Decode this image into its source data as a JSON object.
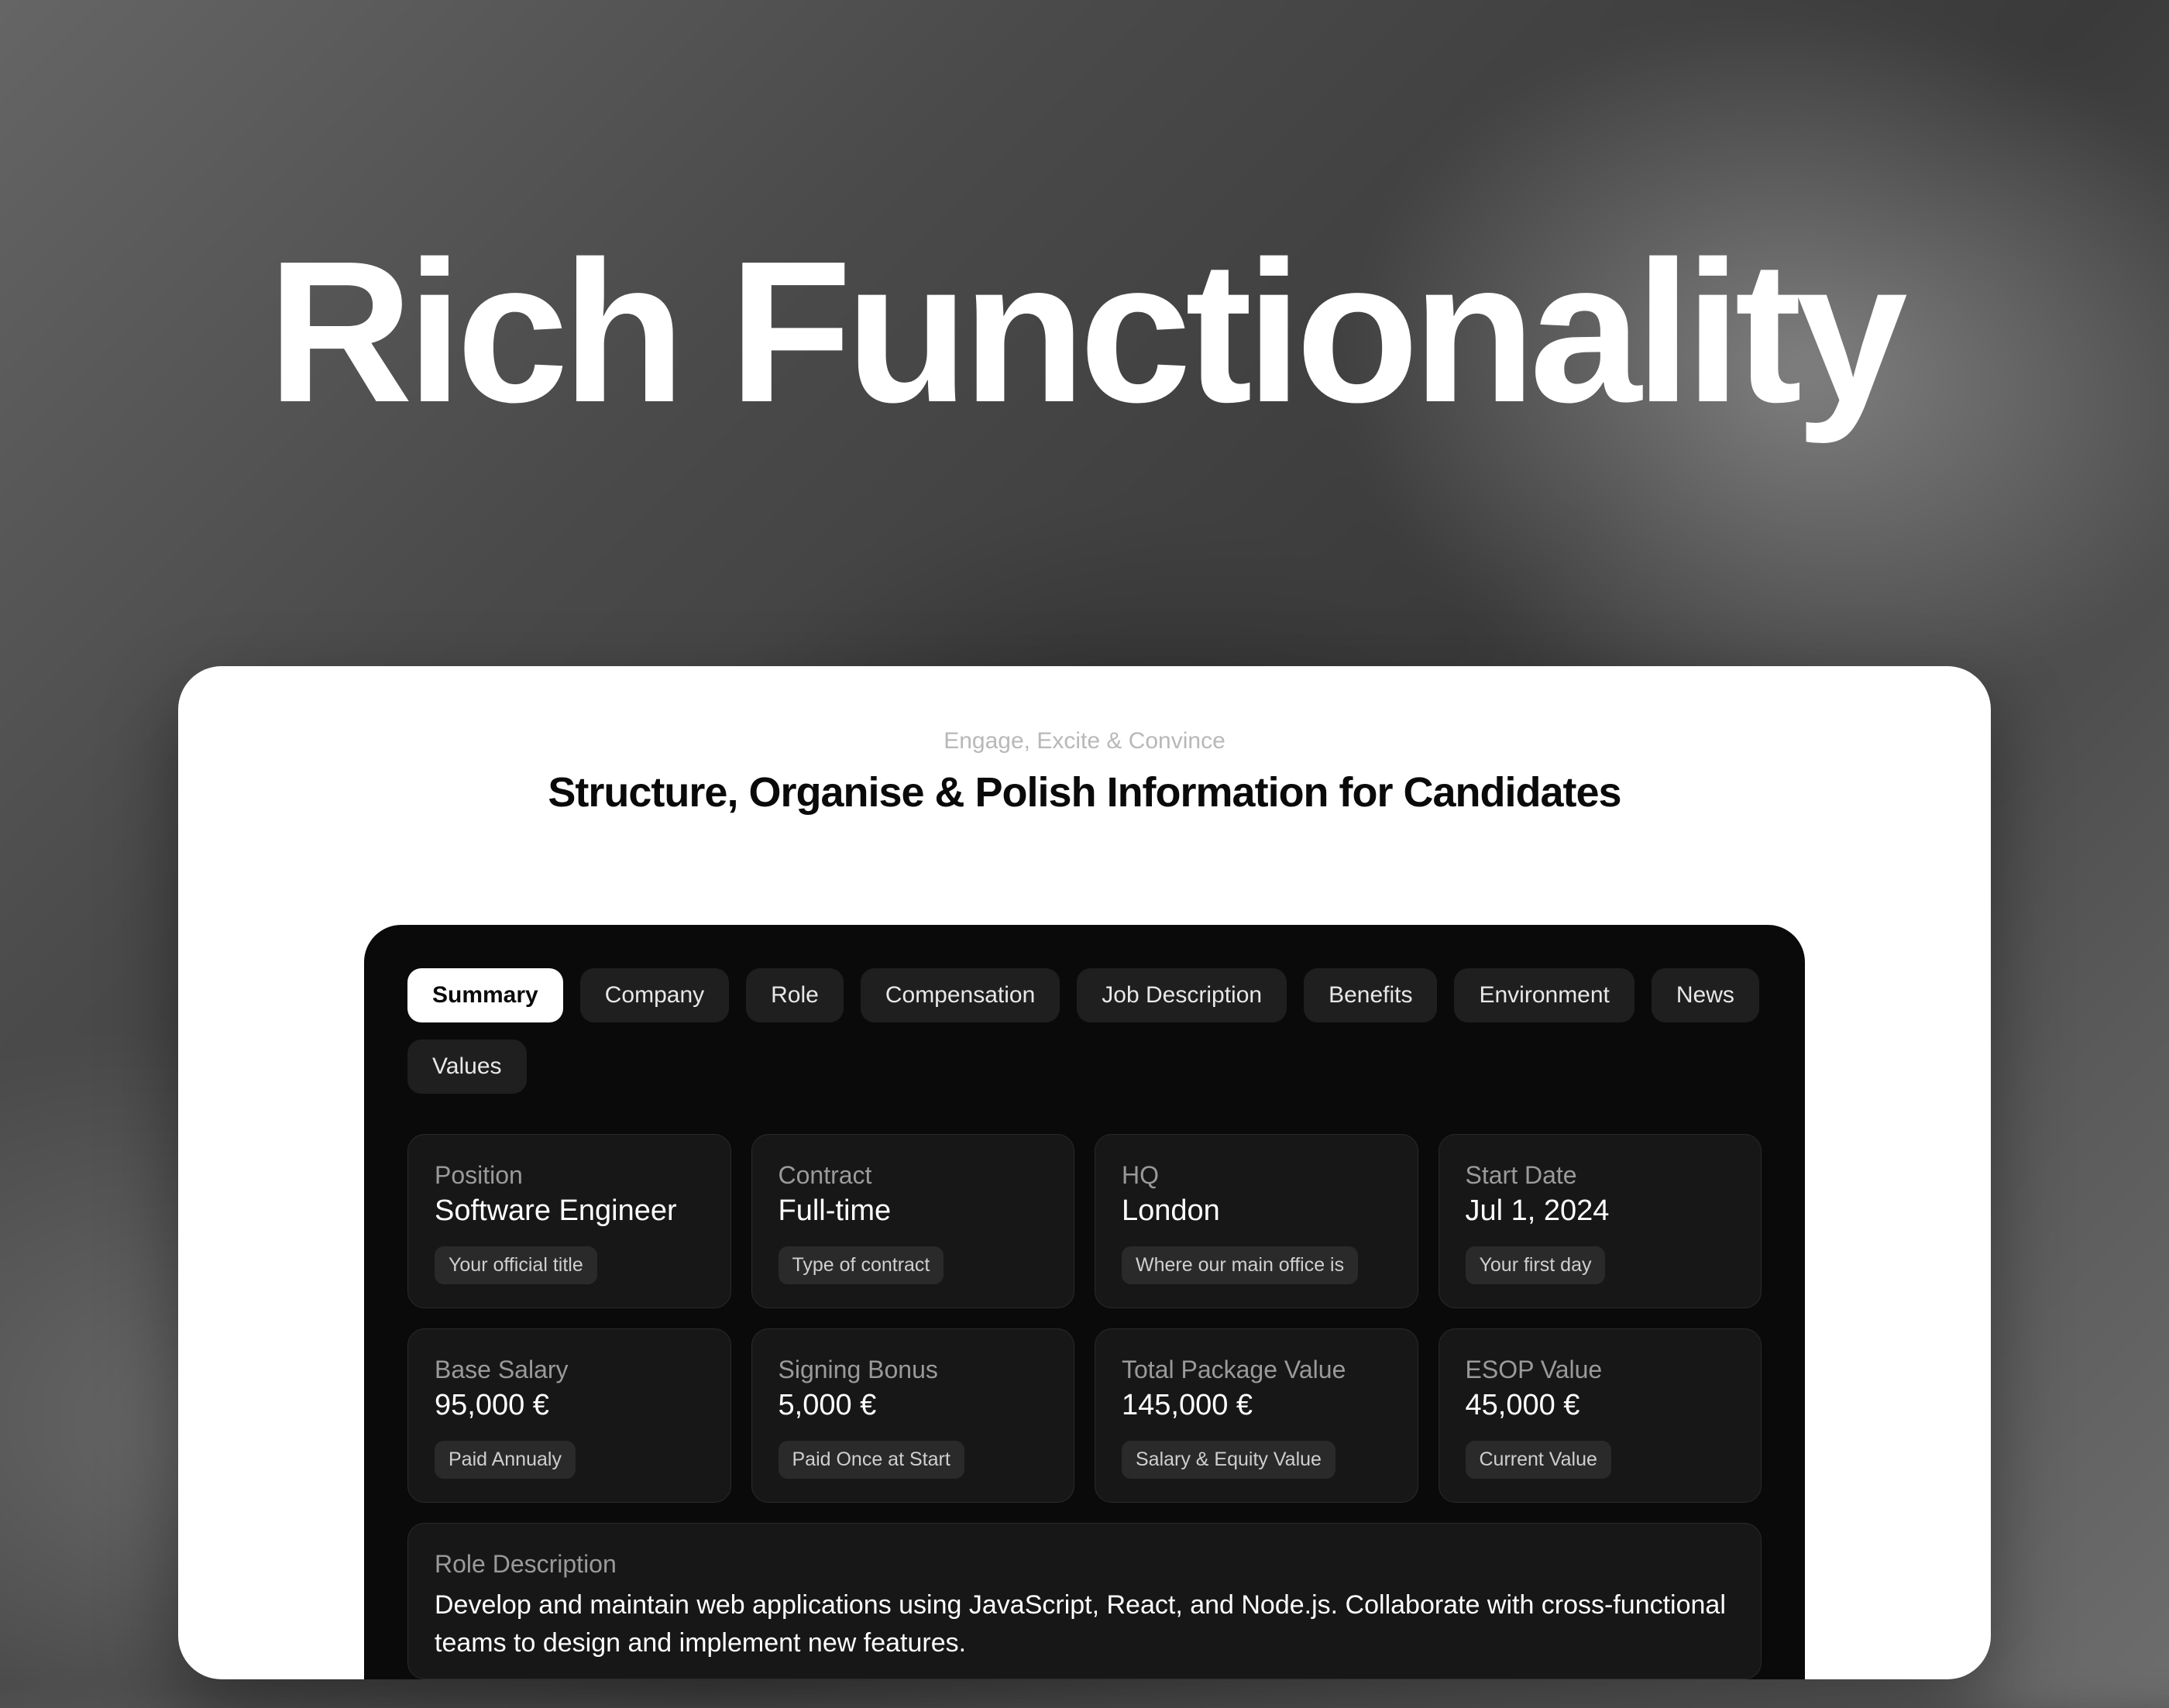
{
  "hero": {
    "title": "Rich Functionality"
  },
  "card": {
    "eyebrow": "Engage, Excite & Convince",
    "heading": "Structure, Organise & Polish Information for Candidates"
  },
  "panel": {
    "tabs": [
      {
        "label": "Summary",
        "active": true
      },
      {
        "label": "Company",
        "active": false
      },
      {
        "label": "Role",
        "active": false
      },
      {
        "label": "Compensation",
        "active": false
      },
      {
        "label": "Job Description",
        "active": false
      },
      {
        "label": "Benefits",
        "active": false
      },
      {
        "label": "Environment",
        "active": false
      },
      {
        "label": "News",
        "active": false
      },
      {
        "label": "Values",
        "active": false
      }
    ],
    "tiles_row1": [
      {
        "label": "Position",
        "value": "Software Engineer",
        "tag": "Your official title"
      },
      {
        "label": "Contract",
        "value": "Full-time",
        "tag": "Type of contract"
      },
      {
        "label": "HQ",
        "value": "London",
        "tag": "Where our main office is"
      },
      {
        "label": "Start Date",
        "value": "Jul 1, 2024",
        "tag": "Your first day"
      }
    ],
    "tiles_row2": [
      {
        "label": "Base Salary",
        "value": "95,000 €",
        "tag": "Paid Annualy"
      },
      {
        "label": "Signing Bonus",
        "value": "5,000 €",
        "tag": "Paid Once at Start"
      },
      {
        "label": "Total Package Value",
        "value": "145,000 €",
        "tag": "Salary & Equity Value"
      },
      {
        "label": "ESOP Value",
        "value": "45,000 €",
        "tag": "Current Value"
      }
    ],
    "description": {
      "label": "Role Description",
      "text": "Develop and maintain web applications using JavaScript, React, and Node.js. Collaborate with cross-functional teams to design and implement new features."
    }
  }
}
